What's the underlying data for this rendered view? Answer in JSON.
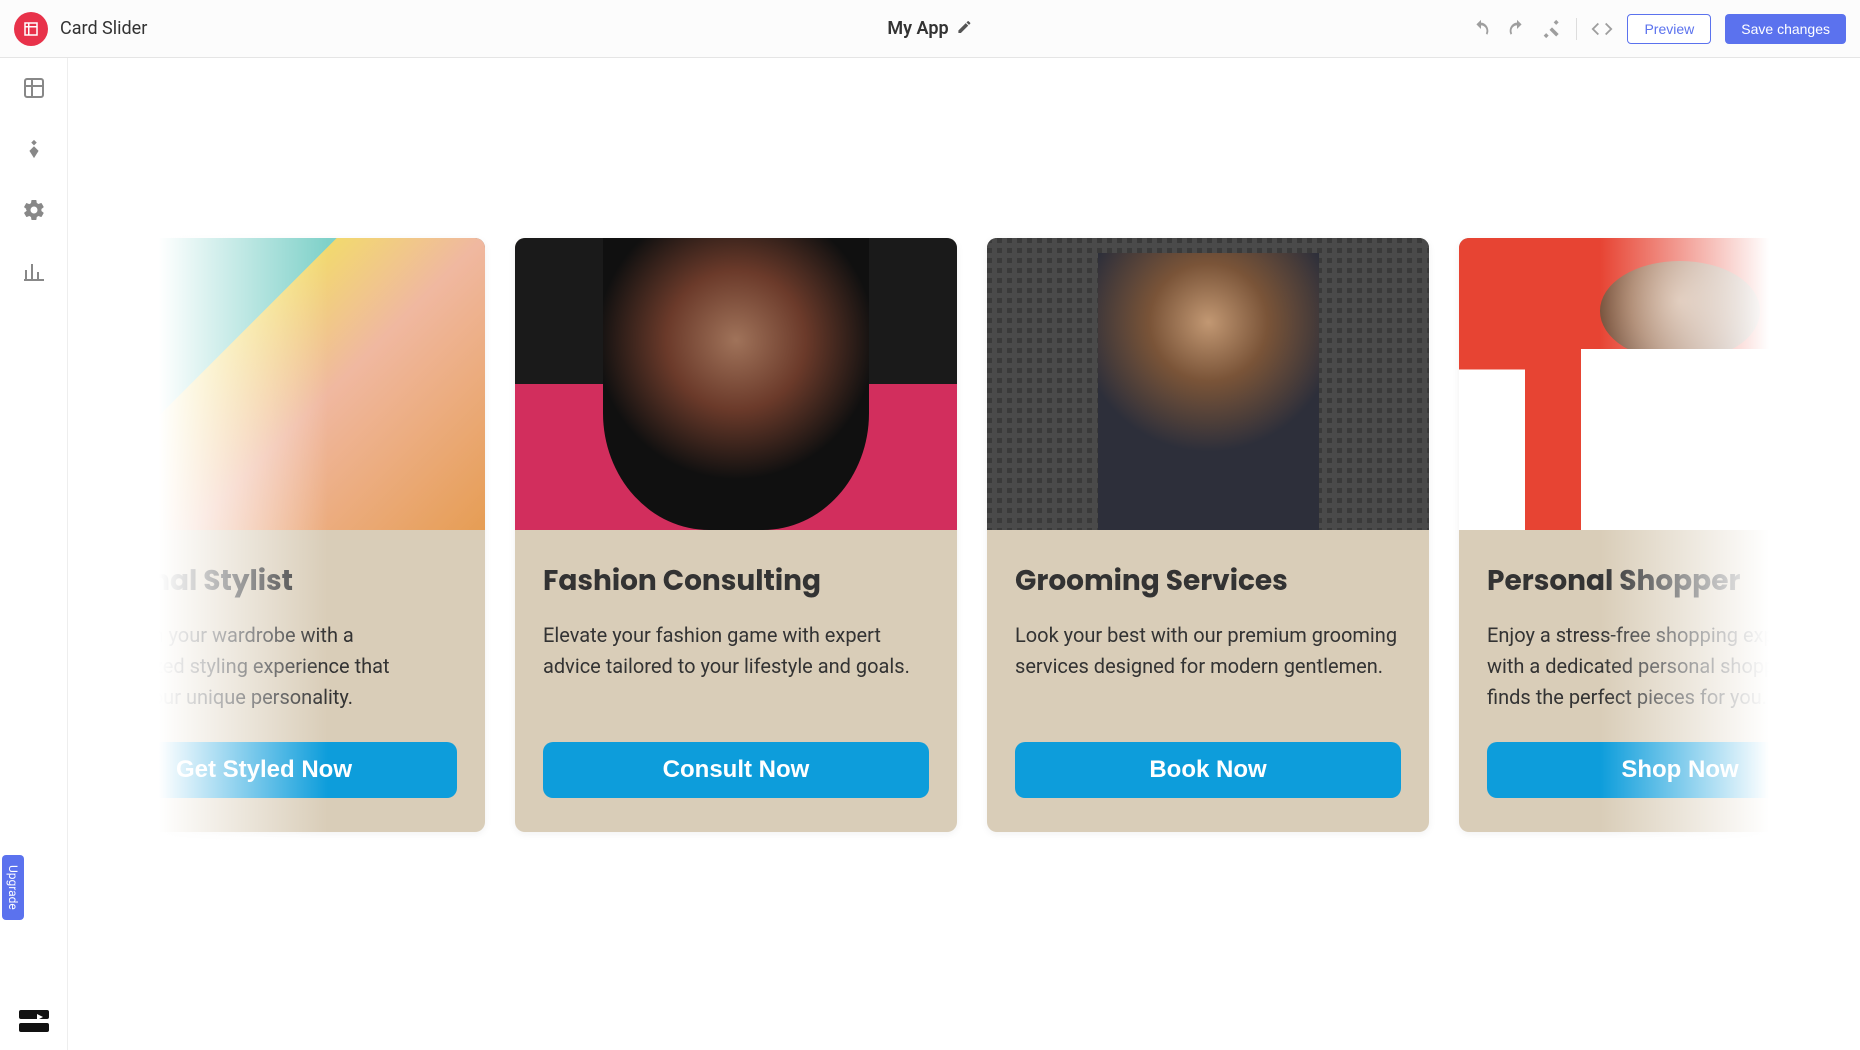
{
  "header": {
    "app_name": "Card Slider",
    "project_title": "My App",
    "preview_label": "Preview",
    "save_label": "Save changes"
  },
  "sidebar": {
    "upgrade_label": "Upgrade"
  },
  "slider": {
    "cards": [
      {
        "title": "Personal Stylist",
        "description": "Transform your wardrobe with a personalized styling experience that reflects your unique personality.",
        "cta": "Get Styled Now"
      },
      {
        "title": "Fashion Consulting",
        "description": "Elevate your fashion game with expert advice tailored to your lifestyle and goals.",
        "cta": "Consult Now"
      },
      {
        "title": "Grooming Services",
        "description": "Look your best with our premium grooming services designed for modern gentlemen.",
        "cta": "Book Now"
      },
      {
        "title": "Personal Shopper",
        "description": "Enjoy a stress-free shopping experience with a dedicated personal shopper who finds the perfect pieces for you.",
        "cta": "Shop Now"
      }
    ]
  },
  "colors": {
    "primary": "#5b72ee",
    "cta": "#0d9ddb",
    "card_bg": "#d9cdb8"
  }
}
